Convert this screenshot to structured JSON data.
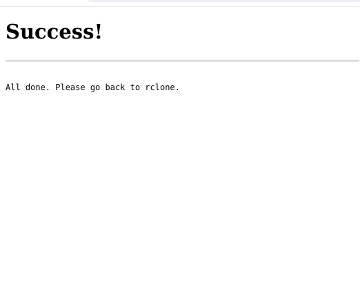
{
  "heading": "Success!",
  "message": "All done. Please go back to rclone."
}
